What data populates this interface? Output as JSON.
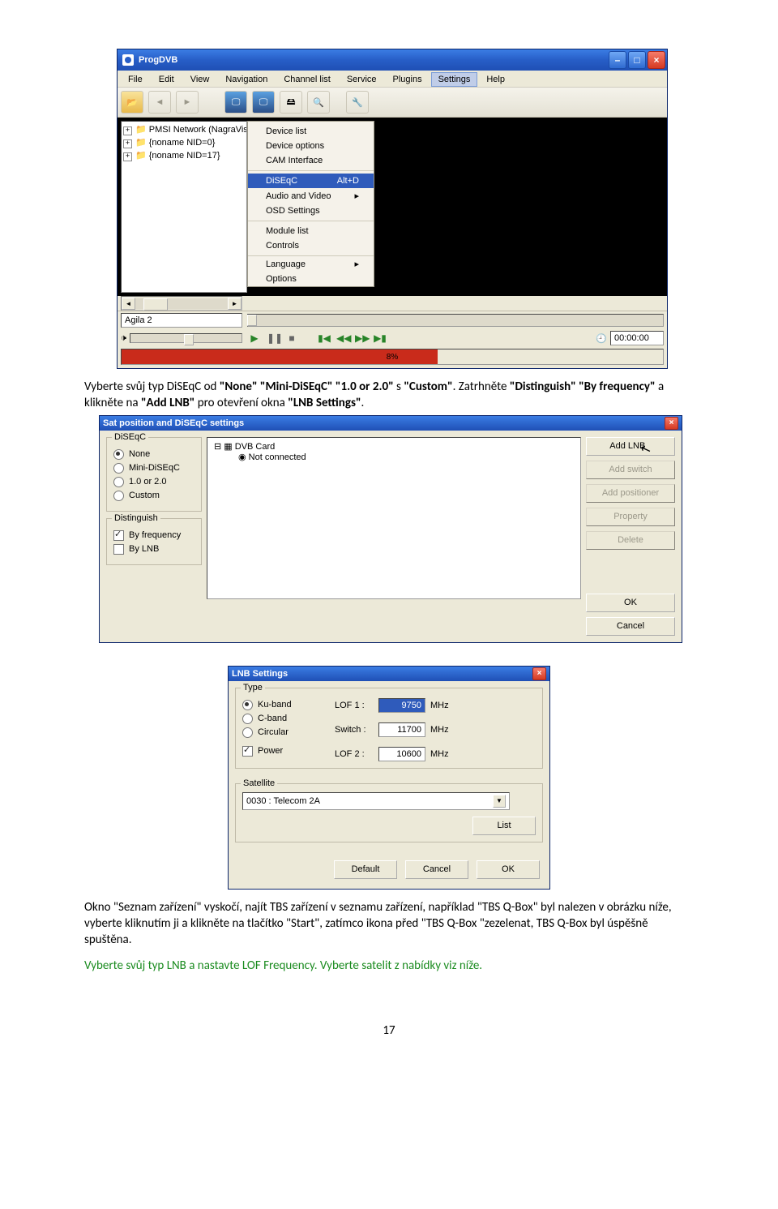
{
  "win1": {
    "title": "ProgDVB",
    "menus": [
      "File",
      "Edit",
      "View",
      "Navigation",
      "Channel list",
      "Service",
      "Plugins",
      "Settings",
      "Help"
    ],
    "open_menu_index": 7,
    "tree": [
      "PMSI Network (NagraVis",
      "{noname NID=0}",
      "{noname NID=17}"
    ],
    "dropdown": {
      "sec1": [
        "Device list",
        "Device options",
        "CAM Interface"
      ],
      "sec2": [
        {
          "label": "DiSEqC",
          "shortcut": "Alt+D",
          "selected": true
        },
        {
          "label": "Audio and Video",
          "submenu": true
        },
        {
          "label": "OSD Settings"
        }
      ],
      "sec3": [
        "Module list",
        "Controls"
      ],
      "sec4": [
        {
          "label": "Language",
          "submenu": true
        },
        {
          "label": "Options"
        }
      ]
    },
    "status": "Agila 2",
    "progress": "8%",
    "time": "00:00:00"
  },
  "para1": {
    "pre": "Vyberte svůj typ DiSEqC od ",
    "b1": "\"None\" \"Mini-DiSEqC\" \"1.0 or 2.0\"",
    "mid1": " s ",
    "b2": "\"Custom\"",
    "mid2": ". Zatrhněte ",
    "b3": "\"Distinguish\" \"By frequency\"",
    "mid3": " a klikněte na ",
    "b4": "\"Add LNB\"",
    "mid4": " pro otevření okna ",
    "b5": "\"LNB Settings\"",
    "end": "."
  },
  "win2": {
    "title": "Sat position and DiSEqC settings",
    "diseqc_label": "DiSEqC",
    "diseqc": [
      "None",
      "Mini-DiSEqC",
      "1.0 or 2.0",
      "Custom"
    ],
    "diseqc_sel": 0,
    "dist_label": "Distinguish",
    "dist": [
      {
        "label": "By frequency",
        "on": true
      },
      {
        "label": "By LNB",
        "on": false
      }
    ],
    "tree": [
      {
        "label": "DVB Card",
        "icon": "card"
      },
      {
        "label": "Not connected",
        "icon": "dot"
      }
    ],
    "buttons": [
      "Add LNB",
      "Add switch",
      "Add positioner",
      "Property",
      "Delete"
    ],
    "ok": "OK",
    "cancel": "Cancel"
  },
  "win3": {
    "title": "LNB Settings",
    "type_label": "Type",
    "types": [
      "Ku-band",
      "C-band",
      "Circular"
    ],
    "type_sel": 0,
    "power_label": "Power",
    "lof1_label": "LOF 1 :",
    "lof1": "9750",
    "mhz": "MHz",
    "switch_label": "Switch :",
    "switch": "11700",
    "lof2_label": "LOF 2 :",
    "lof2": "10600",
    "sat_label": "Satellite",
    "combo": "0030 : Telecom 2A",
    "list": "List",
    "default": "Default",
    "cancel": "Cancel",
    "ok": "OK"
  },
  "para2": "Okno \"Seznam zařízení\" vyskočí, najít TBS zařízení v seznamu zařízení, například \"TBS Q-Box\" byl nalezen v obrázku níže, vyberte kliknutím ji a klikněte na tlačítko \"Start\", zatímco ikona před \"TBS Q-Box \"zezelenat, TBS Q-Box byl úspěšně spuštěna.",
  "para3": "Vyberte svůj typ LNB a nastavte LOF Frequency. Vyberte satelit z nabídky viz níže.",
  "pagenum": "17"
}
